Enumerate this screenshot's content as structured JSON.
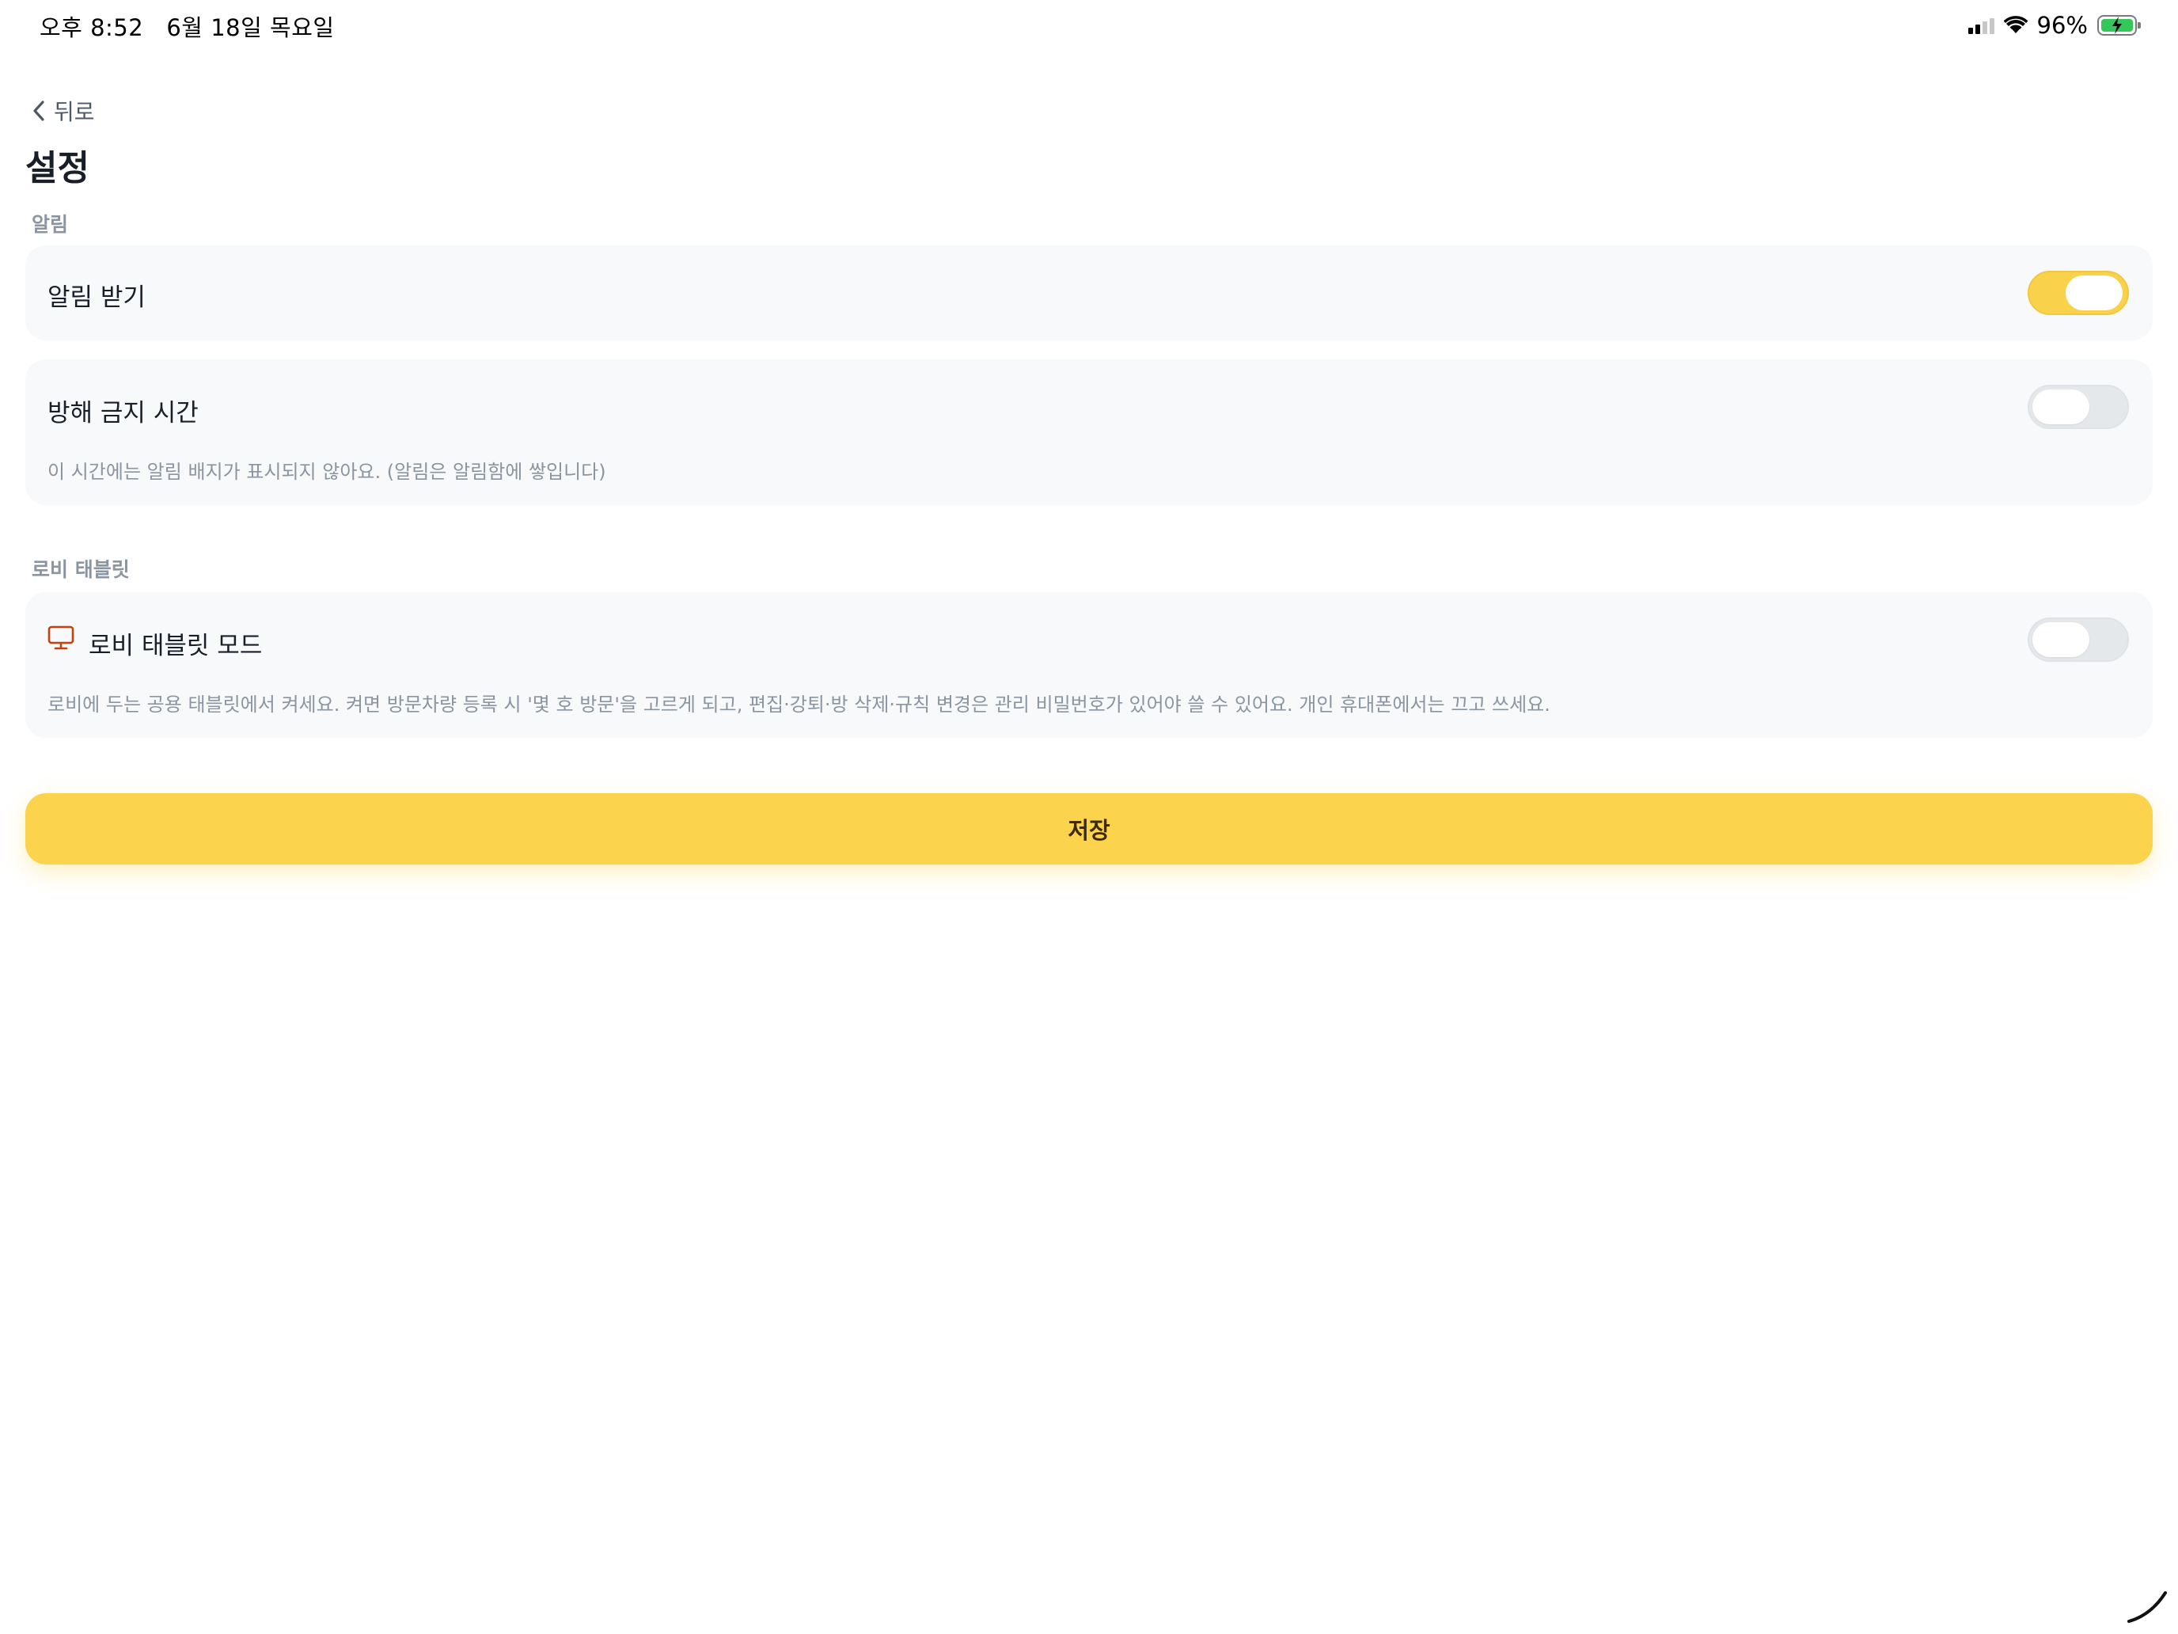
{
  "status_bar": {
    "time": "오후 8:52",
    "date": "6월 18일 목요일",
    "battery_percent": "96%",
    "battery_level": 0.96,
    "battery_charging": true,
    "icons": [
      "cellular-signal-icon",
      "wifi-icon",
      "battery-charging-icon"
    ]
  },
  "nav": {
    "back_label": "뒤로"
  },
  "page": {
    "title": "설정"
  },
  "sections": {
    "notifications": {
      "label": "알림",
      "receive": {
        "title": "알림 받기",
        "enabled": true
      },
      "dnd": {
        "title": "방해 금지 시간",
        "enabled": false,
        "description": "이 시간에는 알림 배지가 표시되지 않아요. (알림은 알림함에 쌓입니다)"
      }
    },
    "lobby": {
      "label": "로비 태블릿",
      "mode": {
        "title": "로비 태블릿 모드",
        "icon": "monitor-icon",
        "enabled": false,
        "description": "로비에 두는 공용 태블릿에서 켜세요. 켜면 방문차량 등록 시 '몇 호 방문'을 고르게 되고, 편집·강퇴·방 삭제·규칙 변경은 관리 비밀번호가 있어야 쓸 수 있어요. 개인 휴대폰에서는 끄고 쓰세요."
      }
    }
  },
  "actions": {
    "save_label": "저장"
  },
  "colors": {
    "accent": "#fcd34d",
    "toggle_on": "#fad14b",
    "toggle_off": "#e5e8eb",
    "card_bg": "#f8f9fa",
    "muted_text": "#8b95a1",
    "icon_orange": "#c2410c"
  }
}
